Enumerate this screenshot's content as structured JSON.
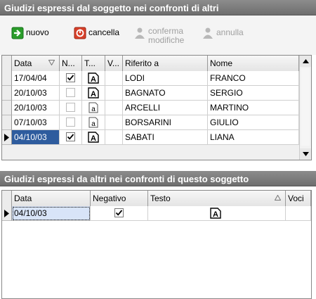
{
  "panel1": {
    "title": "Giudizi espressi dal soggetto nei confronti di altri"
  },
  "toolbar": {
    "nuovo": "nuovo",
    "cancella": "cancella",
    "conferma_1": "conferma",
    "conferma_2": "modifiche",
    "annulla": "annulla"
  },
  "grid1": {
    "columns": [
      "Data",
      "N...",
      "T...",
      "V...",
      "Riferito a",
      "Nome"
    ],
    "rows": [
      {
        "data": "17/04/04",
        "negativo": true,
        "tipo": "A",
        "riferito": "LODI",
        "nome": "FRANCO"
      },
      {
        "data": "20/10/03",
        "negativo": false,
        "tipo": "A",
        "riferito": "BAGNATO",
        "nome": "SERGIO"
      },
      {
        "data": "20/10/03",
        "negativo": false,
        "tipo": "a",
        "riferito": "ARCELLI",
        "nome": "MARTINO"
      },
      {
        "data": "07/10/03",
        "negativo": false,
        "tipo": "a",
        "riferito": "BORSARINI",
        "nome": "GIULIO"
      },
      {
        "data": "04/10/03",
        "negativo": true,
        "tipo": "A",
        "riferito": "SABATI",
        "nome": "LIANA"
      }
    ]
  },
  "panel2": {
    "title": "Giudizi espressi da altri nei confronti di questo soggetto"
  },
  "grid2": {
    "columns": [
      "Data",
      "Negativo",
      "Testo",
      "Voci"
    ],
    "rows": [
      {
        "data": "04/10/03",
        "negativo": true,
        "testo_icon": "A"
      }
    ]
  },
  "colors": {
    "title_bar": "#7a7a7a",
    "selection": "#2e5c9e",
    "add_icon": "#2a9d2a",
    "delete_icon": "#d8402a"
  },
  "icons": [
    "plus-arrow-icon",
    "delete-icon",
    "confirm-user-icon",
    "cancel-user-icon",
    "sort-down-icon",
    "text-a-icon",
    "checkmark-icon",
    "row-pointer-icon",
    "scroll-up-icon",
    "scroll-down-icon"
  ]
}
